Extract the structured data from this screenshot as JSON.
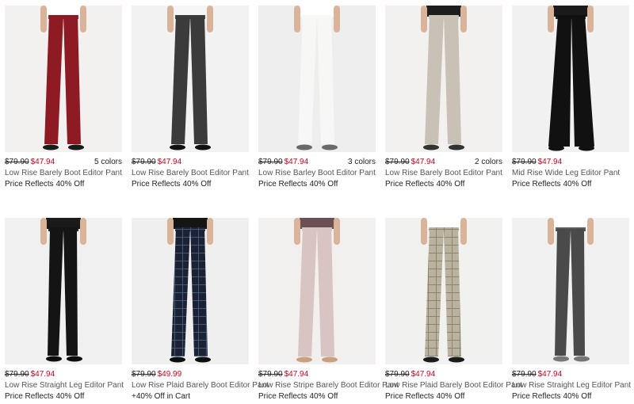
{
  "products": [
    {
      "original_price": "$79.90",
      "sale_price": "$47.94",
      "colors": "5 colors",
      "name": "Low Rise Barely Boot Editor Pant",
      "promo": "Price Reflects 40% Off",
      "pant_color": "#8e1a24",
      "bg": "#f3f1f0",
      "style": "boot",
      "pattern": "solid",
      "shoe_color": "#1a1a1a",
      "top_color": "#ffffff"
    },
    {
      "original_price": "$79.90",
      "sale_price": "$47.94",
      "colors": "",
      "name": "Low Rise Barely Boot Editor Pant",
      "promo": "Price Reflects 40% Off",
      "pant_color": "#3b3b3b",
      "bg": "#f2f2f2",
      "style": "boot",
      "pattern": "solid",
      "shoe_color": "#111111",
      "top_color": "#f6f6f6"
    },
    {
      "original_price": "$79.90",
      "sale_price": "$47.94",
      "colors": "3 colors",
      "name": "Low Rise Barley Boot Editor Pant",
      "promo": "Price Reflects 40% Off",
      "pant_color": "#f7f7f5",
      "bg": "#eeeeee",
      "style": "boot",
      "pattern": "solid",
      "shoe_color": "#6a6a6a",
      "top_color": "#ffffff"
    },
    {
      "original_price": "$79.90",
      "sale_price": "$47.94",
      "colors": "2 colors",
      "name": "Low Rise Barely Boot Editor Pant",
      "promo": "Price Reflects 40% Off",
      "pant_color": "#c9c0b6",
      "bg": "#f2f1f0",
      "style": "boot",
      "pattern": "solid",
      "shoe_color": "#333333",
      "top_color": "#1d1d1d"
    },
    {
      "original_price": "$79.90",
      "sale_price": "$47.94",
      "colors": "",
      "name": "Mid Rise Wide Leg Editor Pant",
      "promo": "Price Reflects 40% Off",
      "pant_color": "#111111",
      "bg": "#f1f1f1",
      "style": "wide",
      "pattern": "solid",
      "shoe_color": "#111111",
      "top_color": "#1a1a1a"
    },
    {
      "original_price": "$79.90",
      "sale_price": "$47.94",
      "colors": "",
      "name": "Low Rise Straight Leg Editor Pant",
      "promo": "Price Reflects 40% Off",
      "pant_color": "#141414",
      "bg": "#f0f0f0",
      "style": "straight",
      "pattern": "solid",
      "shoe_color": "#0e0e0e",
      "top_color": "#1a1a1a"
    },
    {
      "original_price": "$79.90",
      "sale_price": "$49.99",
      "colors": "",
      "name": "Low Rise Plaid Barely Boot Editor Pant",
      "promo": "+40% Off in Cart",
      "pant_color": "#1c2233",
      "bg": "#efefef",
      "style": "boot",
      "pattern": "plaid-navy",
      "shoe_color": "#0e0e0e",
      "top_color": "#151515"
    },
    {
      "original_price": "$79.90",
      "sale_price": "$47.94",
      "colors": "",
      "name": "Low Rise Stripe Barely Boot Editor Pant",
      "promo": "Price Reflects 40% Off",
      "pant_color": "#d8c4c2",
      "bg": "#f2f0ef",
      "style": "boot",
      "pattern": "solid",
      "shoe_color": "#c8a184",
      "top_color": "#6b4f55"
    },
    {
      "original_price": "$79.90",
      "sale_price": "$47.94",
      "colors": "",
      "name": "Low Rise Plaid Barely Boot Editor Pant",
      "promo": "Price Reflects 40% Off",
      "pant_color": "#b9b29c",
      "bg": "#f1f1f0",
      "style": "boot",
      "pattern": "plaid-tan",
      "shoe_color": "#1b1b1b",
      "top_color": "#ffffff"
    },
    {
      "original_price": "$79.90",
      "sale_price": "$47.94",
      "colors": "",
      "name": "Low Rise Straight Leg Editor Pant",
      "promo": "Price Reflects 40% Off",
      "pant_color": "#4a4a4a",
      "bg": "#f1f1f1",
      "style": "straight",
      "pattern": "solid",
      "shoe_color": "#777777",
      "top_color": "#ffffff"
    }
  ]
}
